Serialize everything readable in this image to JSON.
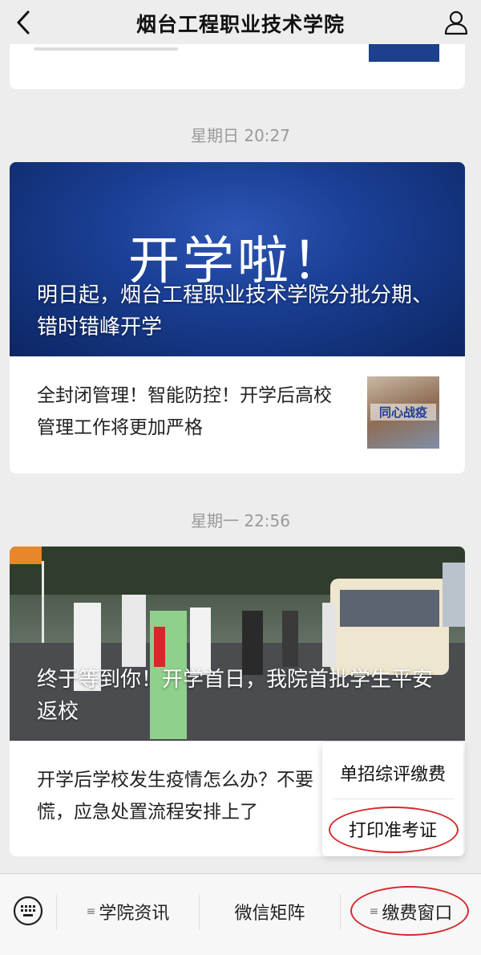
{
  "header": {
    "title": "烟台工程职业技术学院",
    "back_icon": "chevron-left-icon",
    "profile_icon": "person-icon"
  },
  "feed": {
    "messages": [
      {
        "time": "星期日 20:27",
        "banner_headline": "开学啦！",
        "banner_caption": "明日起，烟台工程职业技术学院分批分期、错时错峰开学",
        "sub_article": {
          "text": "全封闭管理！智能防控！开学后高校管理工作将更加严格",
          "thumb_text": "同心战疫"
        }
      },
      {
        "time": "星期一 22:56",
        "banner_caption": "终于等到你！开学首日，我院首批学生平安返校",
        "sub_article": {
          "text": "开学后学校发生疫情怎么办？不要慌，应急处置流程安排上了"
        }
      }
    ]
  },
  "popup_menu": {
    "items": [
      "单招综评缴费",
      "打印准考证"
    ]
  },
  "bottom_bar": {
    "keyboard_icon": "keyboard-icon",
    "tabs": [
      {
        "label": "学院资讯",
        "has_menu": true
      },
      {
        "label": "微信矩阵",
        "has_menu": false
      },
      {
        "label": "缴费窗口",
        "has_menu": true
      }
    ]
  },
  "colors": {
    "background": "#ededed",
    "banner_blue": "#1a3f95",
    "annotation_red": "#d8282b",
    "time_gray": "#9a9a9a"
  }
}
